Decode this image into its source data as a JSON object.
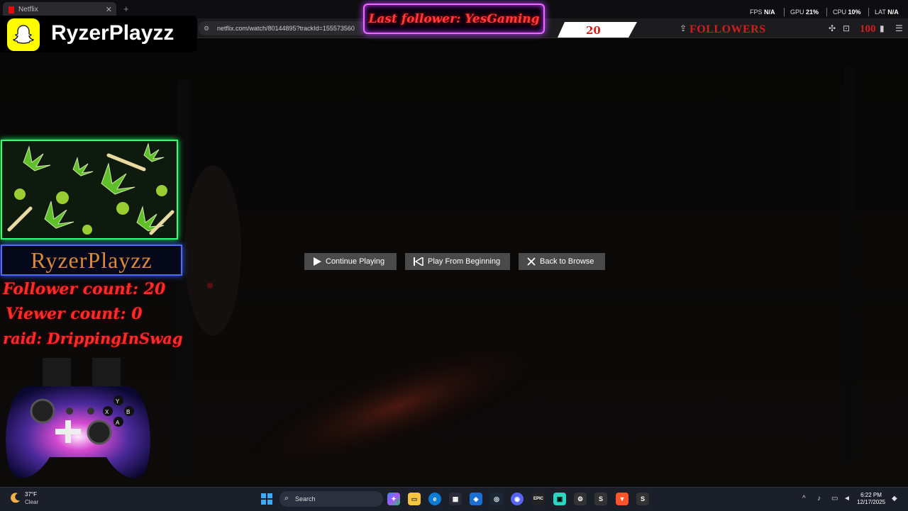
{
  "browser": {
    "tab_title": "Netflix",
    "url": "netflix.com/watch/80144895?trackId=155573560"
  },
  "perf": {
    "fps_label": "FPS",
    "fps_value": "N/A",
    "gpu_label": "GPU",
    "gpu_value": "21%",
    "cpu_label": "CPU",
    "cpu_value": "10%",
    "lat_label": "LAT",
    "lat_value": "N/A"
  },
  "overlay": {
    "streamer_name": "RyzerPlayzz",
    "last_follower": "Last follower: YesGaming",
    "goal_count": "20",
    "goal_label": "FOLLOWERS",
    "goal_target": "100",
    "panel_name": "RyzerPlayzz",
    "follower_count": "Follower count: 20",
    "viewer_count": "Viewer count: 0",
    "raid": "raid: DrippingInSwag"
  },
  "dialog": {
    "continue_label": "Continue Playing",
    "beginning_label": "Play From Beginning",
    "back_label": "Back to Browse"
  },
  "taskbar": {
    "temperature": "37°F",
    "condition": "Clear",
    "search_placeholder": "Search",
    "time": "6:22 PM",
    "date": "12/17/2025"
  },
  "colors": {
    "accent_red": "#ff2a2a",
    "neon_purple": "#e86bff",
    "neon_green": "#34ff77",
    "neon_blue": "#4f6bff",
    "snap_yellow": "#fffc00"
  }
}
